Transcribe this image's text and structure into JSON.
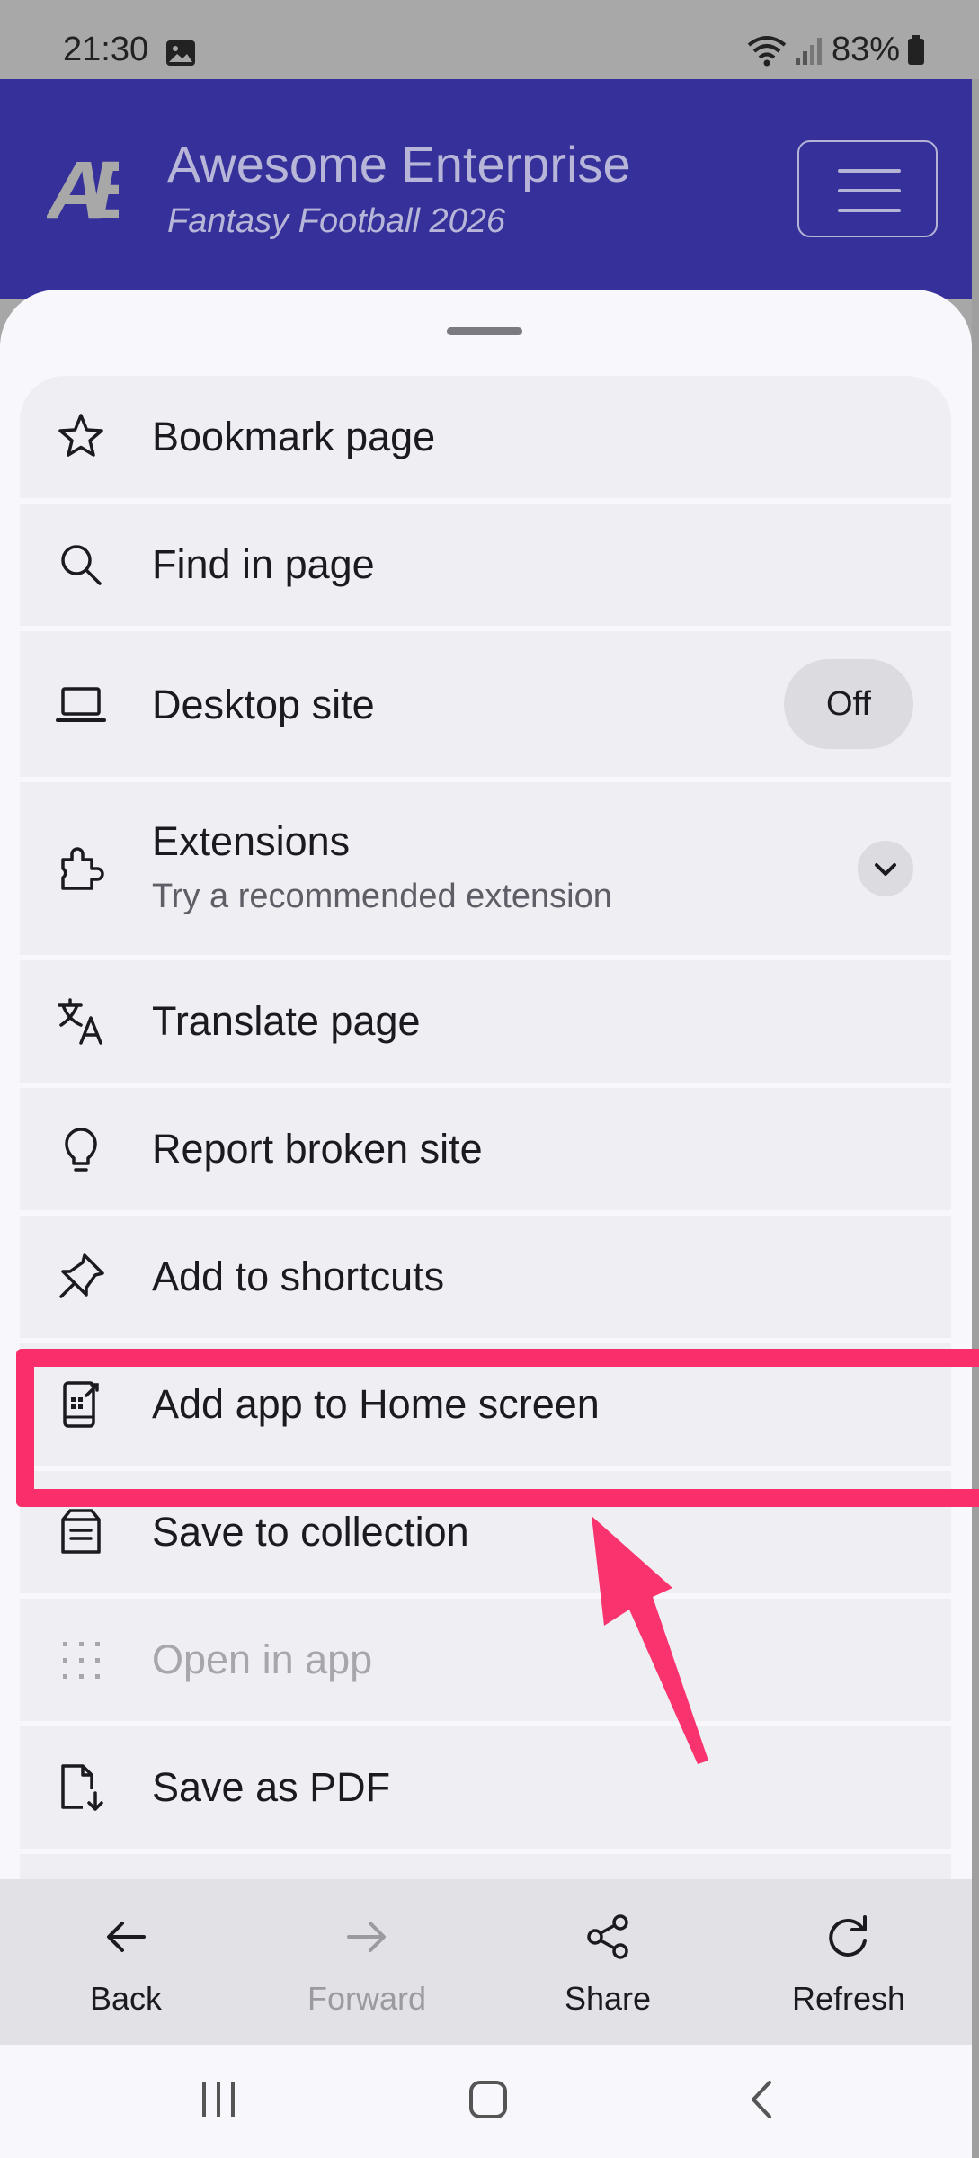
{
  "status_bar": {
    "time": "21:30",
    "battery": "83%"
  },
  "website": {
    "logo_text": "AE",
    "title": "Awesome Enterprise",
    "subtitle": "Fantasy Football 2026"
  },
  "menu": {
    "items": [
      {
        "label": "Bookmark page",
        "icon": "star-icon"
      },
      {
        "label": "Find in page",
        "icon": "search-icon"
      },
      {
        "label": "Desktop site",
        "icon": "laptop-icon",
        "toggle_label": "Off"
      },
      {
        "label": "Extensions",
        "sublabel": "Try a recommended extension",
        "icon": "puzzle-icon"
      },
      {
        "label": "Translate page",
        "icon": "translate-icon"
      },
      {
        "label": "Report broken site",
        "icon": "lightbulb-icon"
      },
      {
        "label": "Add to shortcuts",
        "icon": "pin-icon"
      },
      {
        "label": "Add app to Home screen",
        "icon": "add-to-homescreen-icon"
      },
      {
        "label": "Save to collection",
        "icon": "collection-icon"
      },
      {
        "label": "Open in app",
        "icon": "grid-dots-icon",
        "disabled": true
      },
      {
        "label": "Save as PDF",
        "icon": "pdf-download-icon"
      }
    ]
  },
  "toolbar": {
    "back": "Back",
    "forward": "Forward",
    "share": "Share",
    "refresh": "Refresh"
  },
  "colors": {
    "header_bg": "#35309a",
    "highlight": "#fa2e6a",
    "arrow": "#f8336e"
  }
}
